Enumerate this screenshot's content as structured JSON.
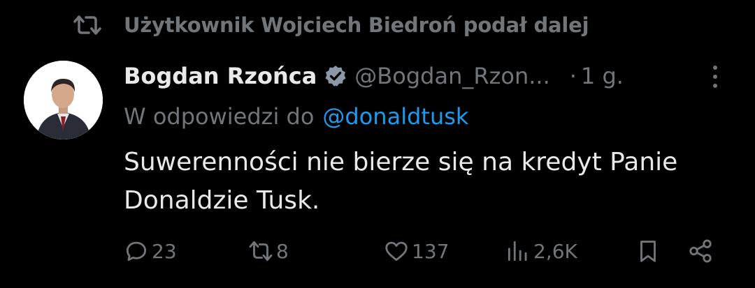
{
  "repost": {
    "label": "Użytkownik Wojciech Biedroń podał dalej"
  },
  "tweet": {
    "author_name": "Bogdan Rzońca",
    "handle": "@Bogdan_Rzon...",
    "separator": "·",
    "time": "1 g.",
    "reply_prefix": "W odpowiedzi do",
    "reply_mention": "@donaldtusk",
    "text_line1": "Suwerenności nie bierze się na kredyt Panie",
    "text_line2": "Donaldzie Tusk."
  },
  "actions": {
    "replies": "23",
    "reposts": "8",
    "likes": "137",
    "views": "2,6K"
  },
  "colors": {
    "background": "#000000",
    "primary_text": "#e7e9ea",
    "secondary_text": "#71767b",
    "link": "#1d9bf0"
  }
}
